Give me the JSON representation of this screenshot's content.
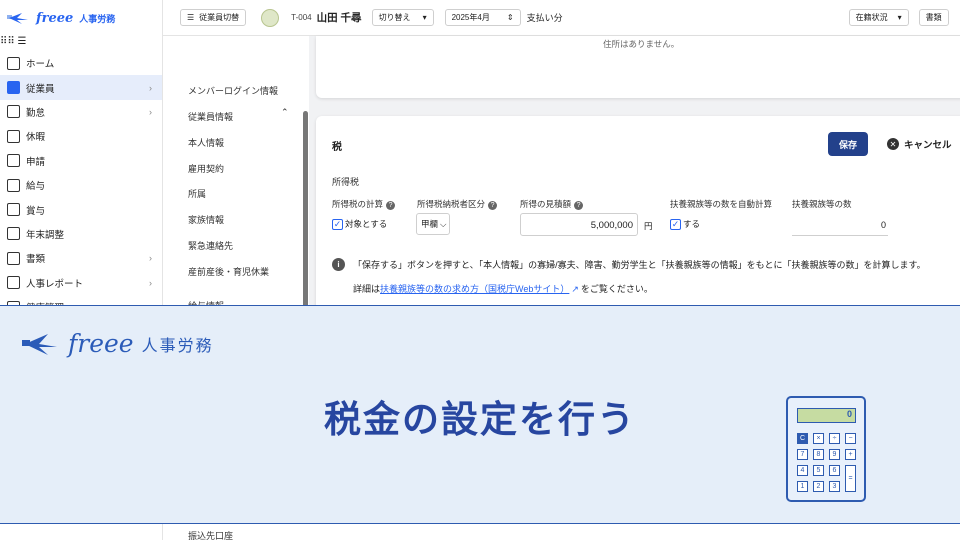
{
  "brand": {
    "name": "freee",
    "product": "人事労務"
  },
  "nav": [
    {
      "label": "ホーム",
      "icon": "home-icon",
      "chevron": false
    },
    {
      "label": "従業員",
      "icon": "employee-icon",
      "chevron": true,
      "active": true
    },
    {
      "label": "勤怠",
      "icon": "attendance-icon",
      "chevron": true
    },
    {
      "label": "休暇",
      "icon": "vacation-icon",
      "chevron": false
    },
    {
      "label": "申請",
      "icon": "request-icon",
      "chevron": false
    },
    {
      "label": "給与",
      "icon": "salary-icon",
      "chevron": false
    },
    {
      "label": "賞与",
      "icon": "bonus-icon",
      "chevron": false
    },
    {
      "label": "年末調整",
      "icon": "year-end-icon",
      "chevron": false
    },
    {
      "label": "書類",
      "icon": "document-icon",
      "chevron": true
    },
    {
      "label": "人事レポート",
      "icon": "report-icon",
      "chevron": true
    },
    {
      "label": "健康管理",
      "icon": "health-icon",
      "chevron": true
    }
  ],
  "topbar": {
    "switch_employee": "従業員切替",
    "emp_id": "T-004",
    "emp_name": "山田 千尋",
    "switch": "切り替え",
    "month": "2025年4月",
    "pay_label": "支払い分",
    "status": "在籍状況",
    "docs": "書類"
  },
  "subnav": {
    "login": "メンバーログイン情報",
    "emp_info": "従業員情報",
    "personal": "本人情報",
    "contract": "雇用契約",
    "belong": "所属",
    "family": "家族情報",
    "emergency": "緊急連絡先",
    "maternity": "産前産後・育児休業",
    "salary_info": "給与情報",
    "bank": "振込先口座"
  },
  "top_notice": "住所はありません。",
  "tax": {
    "title": "税",
    "save": "保存",
    "cancel": "キャンセル",
    "section": "所得税",
    "label_calc": "所得税の計算",
    "label_class": "所得税納税者区分",
    "label_income": "所得の見積額",
    "label_auto": "扶養親族等の数を自動計算",
    "label_count": "扶養親族等の数",
    "calc_value": "対象とする",
    "class_value": "甲欄",
    "income_value": "5,000,000",
    "yen": "円",
    "auto_value": "する",
    "count_value": "0",
    "info": "「保存する」ボタンを押すと、「本人情報」の寡婦/寡夫、障害、勤労学生と「扶養親族等の情報」をもとに「扶養親族等の数」を計算します。",
    "detail_prefix": "詳細は",
    "detail_link": "扶養親族等の数の求め方（国税庁Webサイト）",
    "detail_suffix": "をご覧ください。"
  },
  "banner": {
    "logo_name": "freee",
    "logo_product": "人事労務",
    "headline": "税金の設定を行う",
    "calc_display": "0"
  },
  "colors": {
    "brand_blue": "#2864f0",
    "save_navy": "#23418b",
    "banner_bg": "#e5eef9",
    "headline": "#2746a0"
  }
}
